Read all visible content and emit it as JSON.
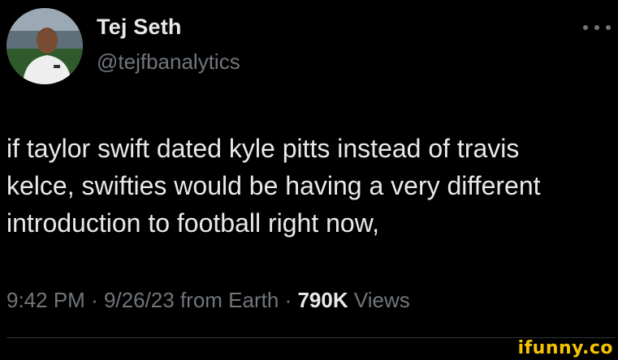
{
  "tweet": {
    "display_name": "Tej Seth",
    "handle": "@tejfbanalytics",
    "more_icon": "more-horizontal-icon",
    "text": "if taylor swift dated kyle pitts instead of travis\nkelce, swifties would be having a very different\nintroduction to football right now,",
    "time": "9:42 PM",
    "separator": "·",
    "date": "9/26/23",
    "source": "from Earth",
    "views_count": "790K",
    "views_label": "Views"
  },
  "watermark": {
    "text": "ifunny.co"
  },
  "colors": {
    "background": "#000000",
    "primary_text": "#e7e9ea",
    "secondary_text": "#71767b",
    "divider": "#2f3336",
    "watermark": "#f5c400"
  }
}
